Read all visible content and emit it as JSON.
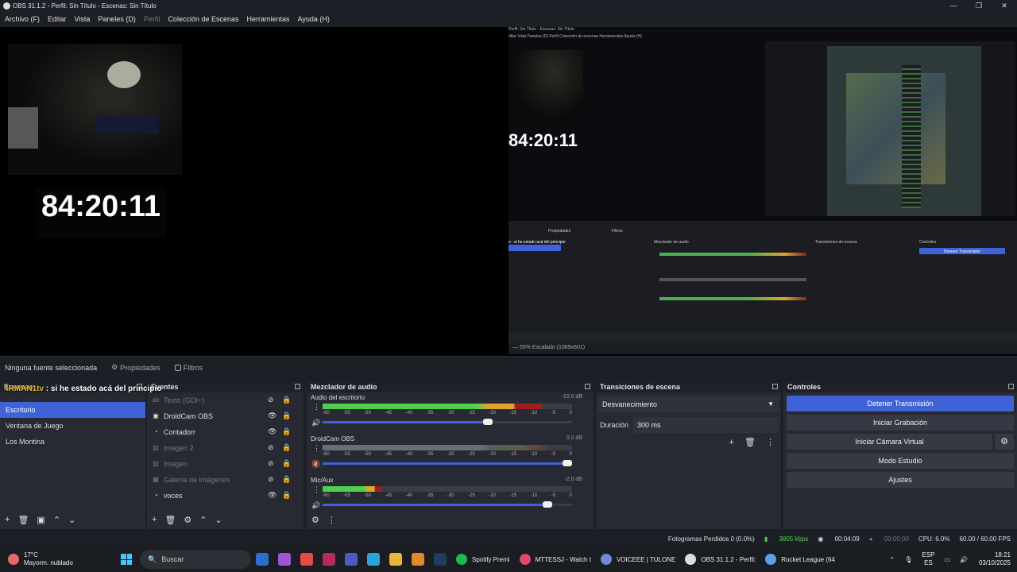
{
  "window": {
    "title": "OBS 31.1.2 - Perfil: Sin Título - Escenas: Sin Título",
    "minimize": "—",
    "maximize": "❐",
    "close": "✕"
  },
  "menu": [
    "Archivo (F)",
    "Editar",
    "Vista",
    "Paneles (D)",
    "Perfil",
    "Colección de Escenas",
    "Herramientas",
    "Ayuda (H)"
  ],
  "preview": {
    "timer": "84:20:11",
    "nested_title": "Perfil: Sin Título - Escenas: Sin Título",
    "nested_menu": "ditar   Vista   Paneles (D)   Perfil   Colección de escenas   Herramientas   Ayuda (H)",
    "nested_timer": "84:20:11",
    "nested_status": "—   55%   Escalado (1069x601)",
    "nested_overlay": "o : si he estado acá del principio",
    "nested_props": "Propiedades",
    "nested_filters": "Filtros",
    "nested_mixer": "Mezclador de audio",
    "nested_trans": "Transiciones de escena",
    "nested_controls": "Controles",
    "nested_stop": "Detener Transmisión"
  },
  "source_toolbar": {
    "no_source": "Ninguna fuente seleccionada",
    "properties": "Propiedades",
    "filters": "Filtros"
  },
  "overlay": {
    "prefix": "4RMAN1tv",
    "text": ": si he estado acá del principio"
  },
  "scenes": {
    "header": "Escenas",
    "items": [
      "Escritorio",
      "Ventana de Juego",
      "Los Montina"
    ],
    "toolbar": [
      "+",
      "🗑",
      "▣",
      "⌃",
      "⌄"
    ]
  },
  "sources": {
    "header": "Fuentes",
    "items": [
      {
        "label": "Texto (GDI+)",
        "icon": "ab",
        "visible": false
      },
      {
        "label": "DroidCam OBS",
        "icon": "▣",
        "visible": true
      },
      {
        "label": "Contadorr",
        "icon": "◔",
        "visible": true
      },
      {
        "label": "Imagen 2",
        "icon": "▨",
        "visible": false
      },
      {
        "label": "Imagen",
        "icon": "▨",
        "visible": false
      },
      {
        "label": "Galería de imágenes",
        "icon": "▦",
        "visible": false
      },
      {
        "label": "voces",
        "icon": "◔",
        "visible": true
      }
    ],
    "toolbar": [
      "+",
      "🗑",
      "⚙",
      "⌃",
      "⌄"
    ]
  },
  "mixer": {
    "header": "Mezclador de audio",
    "scale": [
      "-60",
      "-55",
      "-50",
      "-45",
      "-40",
      "-35",
      "-30",
      "-25",
      "-20",
      "-15",
      "-10",
      "-5",
      "0"
    ],
    "channels": [
      {
        "name": "Audio del escritorio",
        "db": "-10.0 dB",
        "level": 0.88,
        "volume": 0.68,
        "active": true
      },
      {
        "name": "DroidCam OBS",
        "db": "0.0 dB",
        "level": 0.9,
        "volume": 1.0,
        "active": false
      },
      {
        "name": "Mic/Aux",
        "db": "-2.0 dB",
        "level": 0.24,
        "volume": 0.92,
        "active": true
      }
    ]
  },
  "transitions": {
    "header": "Transiciones de escena",
    "type": "Desvanecimiento",
    "duration_label": "Duración",
    "duration": "300 ms"
  },
  "controls": {
    "header": "Controles",
    "stop_stream": "Detener Transmisión",
    "start_recording": "Iniciar Grabación",
    "virtual_cam": "Iniciar Cámara Virtual",
    "studio_mode": "Modo Estudio",
    "settings": "Ajustes"
  },
  "status": {
    "dropped": "Fotogramas Perdidos 0 (0.0%)",
    "bitrate": "3805 kbps",
    "stream_time": "00:04:09",
    "rec_time": "00:00:00",
    "cpu": "CPU: 6.0%",
    "fps": "60.00 / 60.00 FPS"
  },
  "taskbar": {
    "temp": "17°C",
    "weather": "Mayorm. nublado",
    "search": "Buscar",
    "apps": [
      {
        "label": "Spotify Premi",
        "color": "#1db954"
      },
      {
        "label": "MTTESSJ - Watch t",
        "color": "#e04a6a"
      },
      {
        "label": "VOICEEE | TULONE",
        "color": "#7289da"
      },
      {
        "label": "OBS 31.1.2 - Perfil:",
        "color": "#dddddd"
      },
      {
        "label": "Rocket League (64",
        "color": "#5aa0e6"
      }
    ],
    "lang": "ESP",
    "region": "ES",
    "time": "18:21",
    "date": "03/10/2025"
  }
}
